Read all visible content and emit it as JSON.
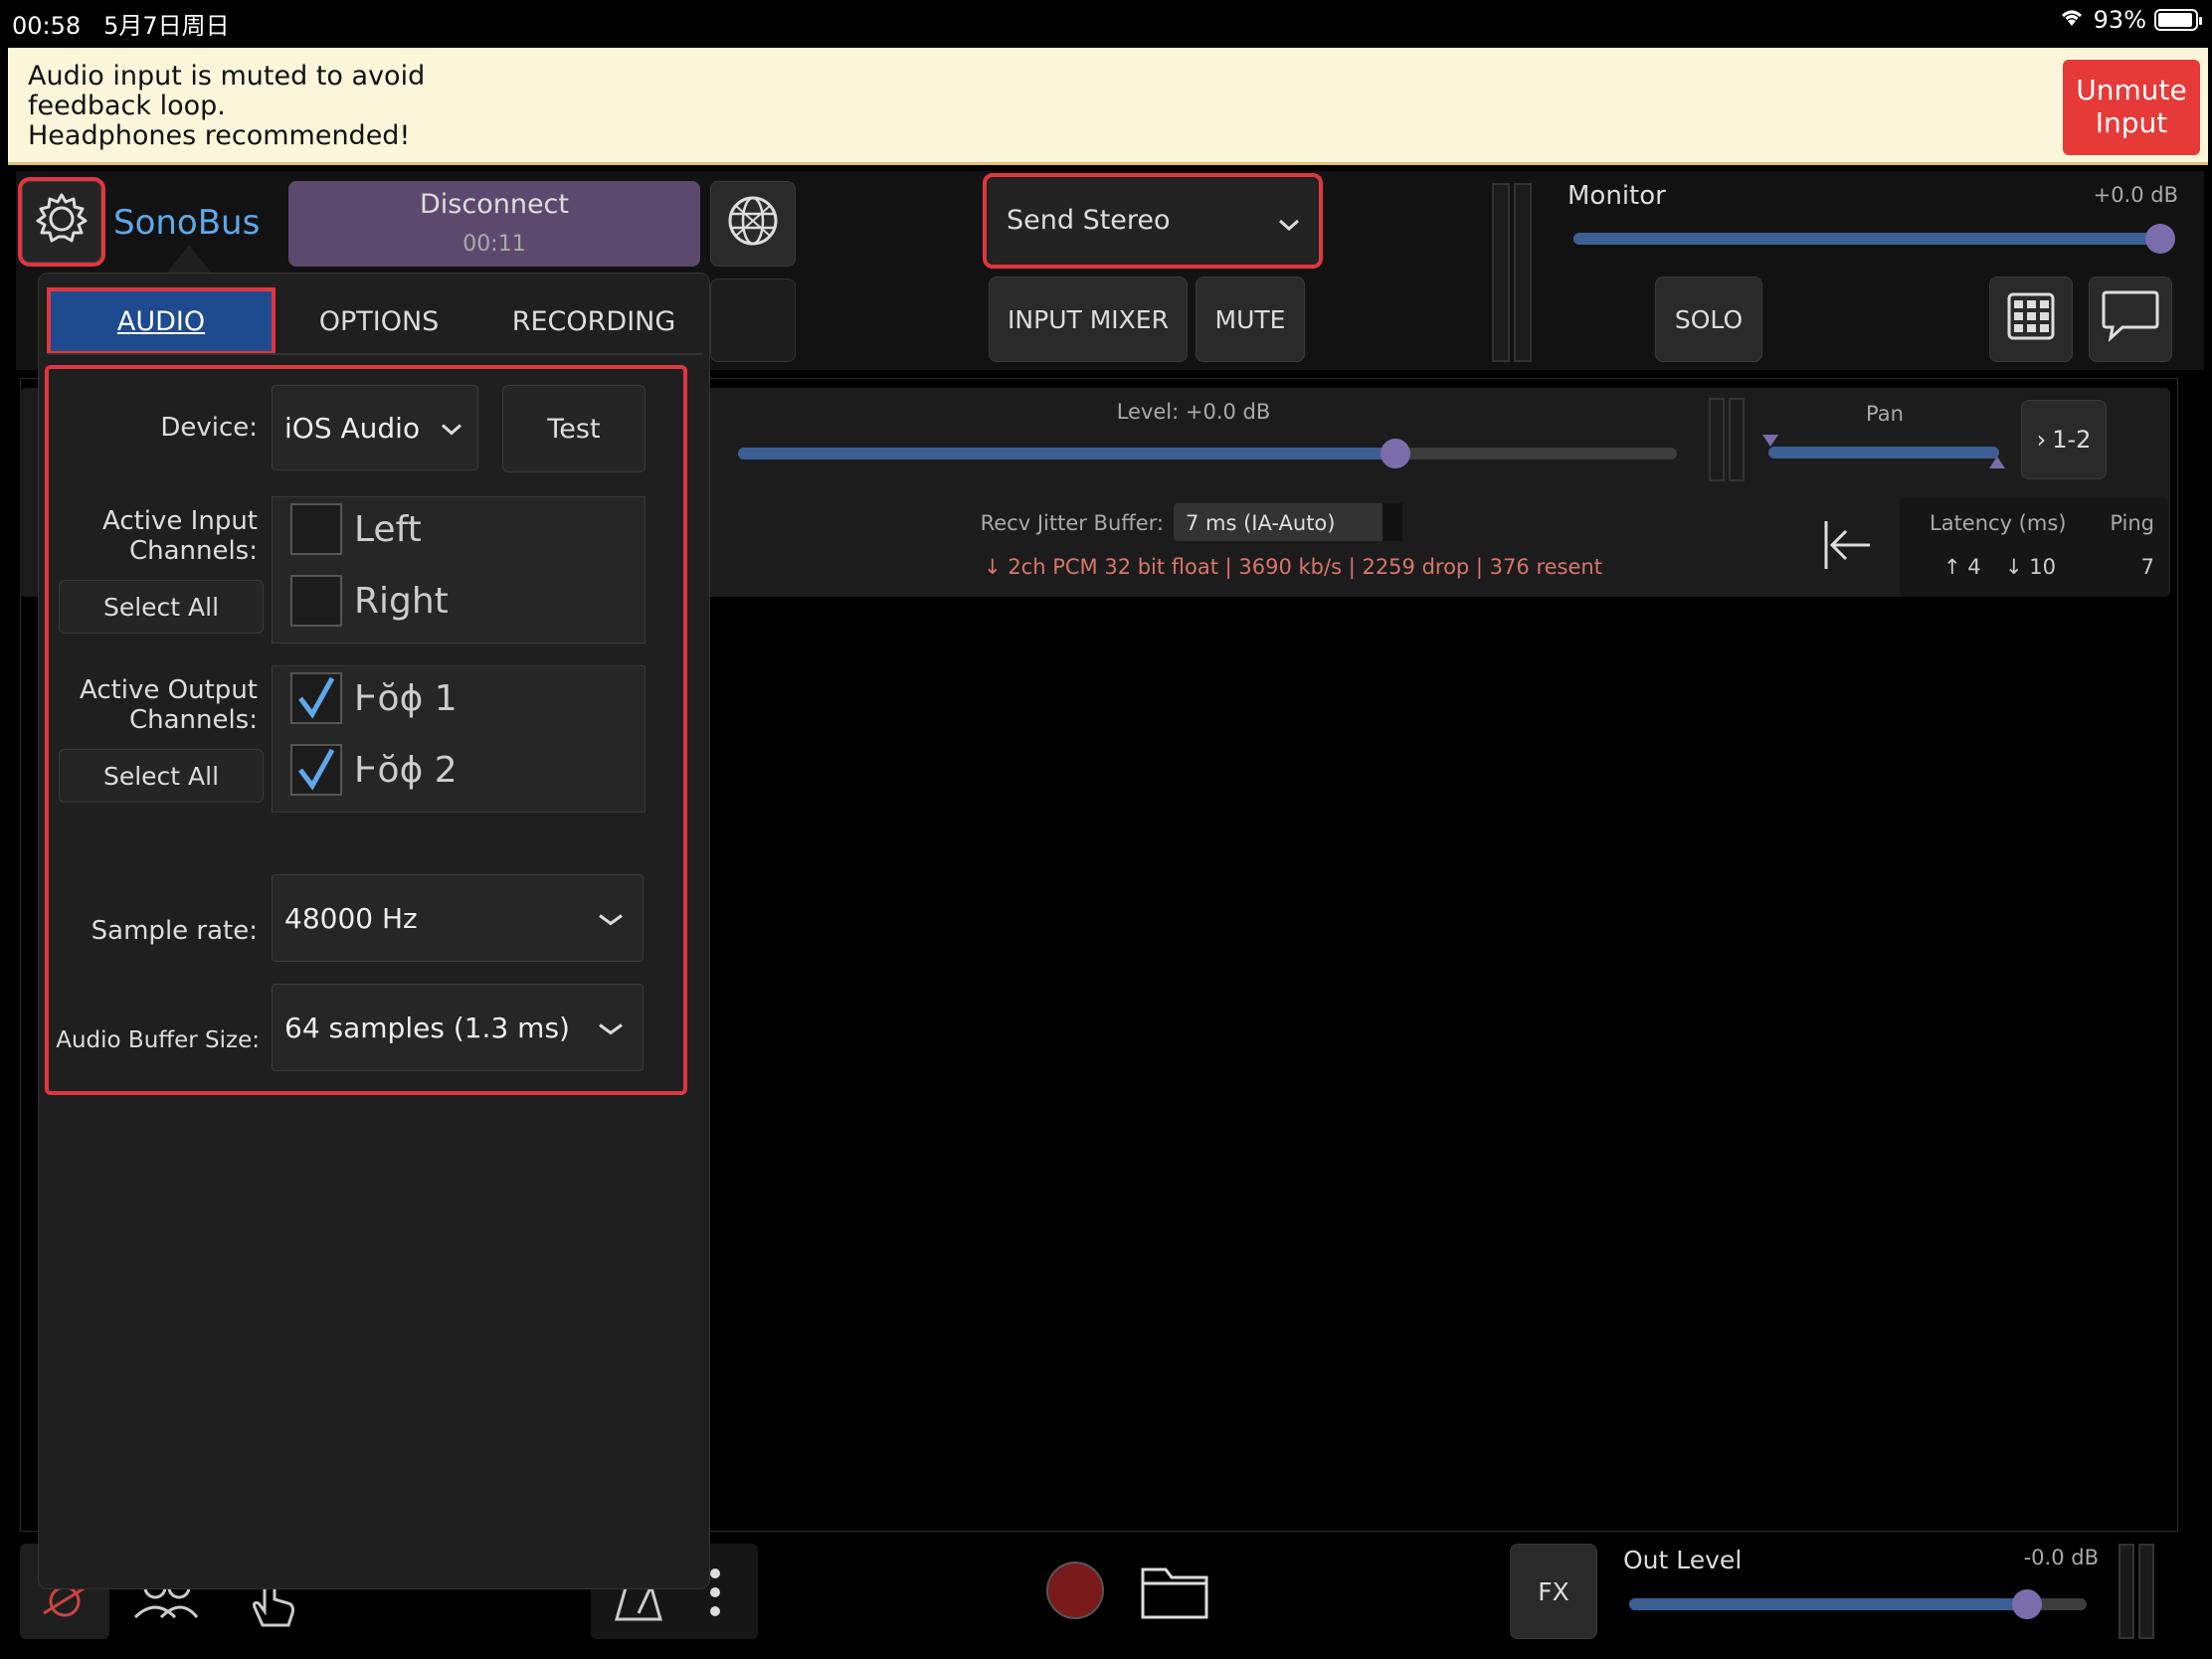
{
  "status_bar": {
    "time": "00:58",
    "date": "5月7日周日",
    "battery": "93%"
  },
  "banner": {
    "line1": "Audio input is muted to avoid",
    "line2": "feedback loop.",
    "line3": "Headphones recommended!",
    "unmute_line1": "Unmute",
    "unmute_line2": "Input"
  },
  "header": {
    "app_name": "SonoBus",
    "disconnect_label": "Disconnect",
    "session_time": "00:11",
    "send_mode": "Send Stereo",
    "input_mixer": "INPUT MIXER",
    "mute": "MUTE",
    "solo": "SOLO",
    "monitor_label": "Monitor",
    "monitor_db": "+0.0 dB",
    "monitor_level": 1.0
  },
  "track": {
    "level_label": "Level: +0.0 dB",
    "level_value": 0.7,
    "pan_label": "Pan",
    "channel_group": "1-2",
    "jitter_label": "Recv Jitter Buffer:",
    "jitter_value": "7 ms (IA-Auto)",
    "stream_info": "↓ 2ch PCM 32 bit float | 3690 kb/s | 2259 drop | 376 resent",
    "latency_label": "Latency (ms)",
    "ping_label": "Ping",
    "latency_up": "↑ 4",
    "latency_down": "↓ 10",
    "ping_value": "7"
  },
  "settings_popup": {
    "tabs": [
      {
        "label": "AUDIO",
        "active": true
      },
      {
        "label": "OPTIONS",
        "active": false
      },
      {
        "label": "RECORDING",
        "active": false
      }
    ],
    "device_label": "Device:",
    "device_value": "iOS Audio",
    "test_button": "Test",
    "active_input_label_1": "Active Input",
    "active_input_label_2": "Channels:",
    "input_channels": [
      {
        "label": "Left",
        "checked": false
      },
      {
        "label": "Right",
        "checked": false
      }
    ],
    "select_all_label": "Select All",
    "active_output_label_1": "Active Output",
    "active_output_label_2": "Channels:",
    "output_channels": [
      {
        "label": "Ⱶŏɸ  1",
        "checked": true
      },
      {
        "label": "Ⱶŏɸ  2",
        "checked": true
      }
    ],
    "sample_rate_label": "Sample rate:",
    "sample_rate_value": "48000 Hz",
    "buffer_label": "Audio Buffer Size:",
    "buffer_value": "64 samples (1.3 ms)"
  },
  "bottom": {
    "fx_label": "FX",
    "out_level_label": "Out Level",
    "out_level_db": "-0.0 dB",
    "out_level": 0.87
  },
  "colors": {
    "accent_blue": "#3c5f94",
    "knob_purple": "#7b6cab",
    "highlight_red": "#e0363f",
    "record_red": "#7a1a1a",
    "disconnect_bg": "#5c4a6e"
  }
}
